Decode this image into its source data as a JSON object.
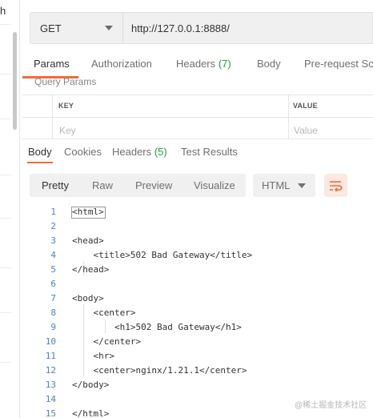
{
  "sidebar": {
    "fragment": "h"
  },
  "request": {
    "method": "GET",
    "url": "http://127.0.0.1:8888/"
  },
  "request_tabs": [
    {
      "label": "Params",
      "count": ""
    },
    {
      "label": "Authorization",
      "count": ""
    },
    {
      "label": "Headers",
      "count": "(7)"
    },
    {
      "label": "Body",
      "count": ""
    },
    {
      "label": "Pre-request Scr",
      "count": ""
    }
  ],
  "query_params": {
    "title": "Query Params",
    "key_header": "KEY",
    "value_header": "VALUE",
    "key_placeholder": "Key",
    "value_placeholder": "Value"
  },
  "response_tabs": [
    {
      "label": "Body",
      "count": ""
    },
    {
      "label": "Cookies",
      "count": ""
    },
    {
      "label": "Headers",
      "count": "(5)"
    },
    {
      "label": "Test Results",
      "count": ""
    }
  ],
  "format": {
    "buttons": [
      "Pretty",
      "Raw",
      "Preview",
      "Visualize"
    ],
    "language": "HTML",
    "wrap_icon": "wrap-lines-icon"
  },
  "code_lines": [
    {
      "num": "1",
      "text": "<html>"
    },
    {
      "num": "2",
      "text": ""
    },
    {
      "num": "3",
      "text": "<head>"
    },
    {
      "num": "4",
      "text": "    <title>502 Bad Gateway</title>"
    },
    {
      "num": "5",
      "text": "</head>"
    },
    {
      "num": "6",
      "text": ""
    },
    {
      "num": "7",
      "text": "<body>"
    },
    {
      "num": "8",
      "text": "    <center>"
    },
    {
      "num": "9",
      "text": "        <h1>502 Bad Gateway</h1>"
    },
    {
      "num": "10",
      "text": "    </center>"
    },
    {
      "num": "11",
      "text": "    <hr>"
    },
    {
      "num": "12",
      "text": "    <center>nginx/1.21.1</center>"
    },
    {
      "num": "13",
      "text": "</body>"
    },
    {
      "num": "14",
      "text": ""
    },
    {
      "num": "15",
      "text": "</html>"
    }
  ],
  "watermark": "@稀土掘金技术社区",
  "colors": {
    "accent": "#f26b3a",
    "count_green": "#23a047",
    "line_number": "#4f7fcf"
  }
}
